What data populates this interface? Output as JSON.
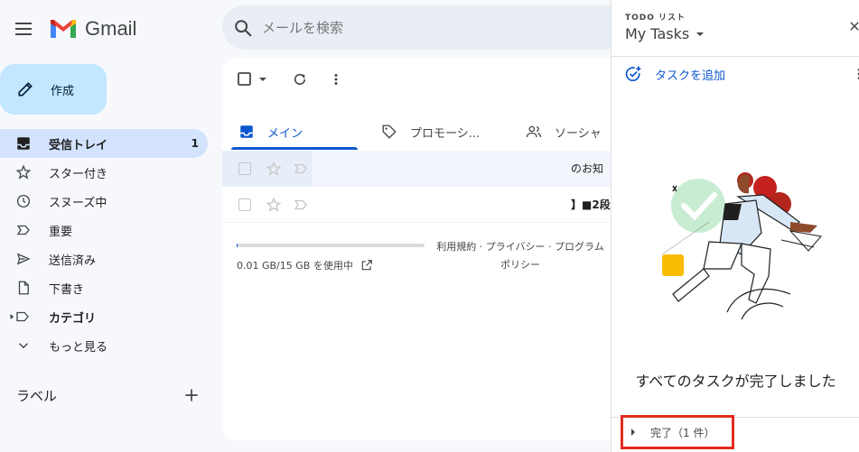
{
  "app": {
    "logo_text": "Gmail"
  },
  "search": {
    "placeholder": "メールを検索"
  },
  "compose": {
    "label": "作成"
  },
  "sidebar": {
    "items": [
      {
        "label": "受信トレイ",
        "count": "1"
      },
      {
        "label": "スター付き"
      },
      {
        "label": "スヌーズ中"
      },
      {
        "label": "重要"
      },
      {
        "label": "送信済み"
      },
      {
        "label": "下書き"
      },
      {
        "label": "カテゴリ"
      },
      {
        "label": "もっと見る"
      }
    ],
    "labels_heading": "ラベル"
  },
  "main": {
    "tabs": [
      {
        "label": "メイン"
      },
      {
        "label": "プロモーシ..."
      },
      {
        "label": "ソーシャ"
      }
    ],
    "emails": [
      {
        "snippet": "のお知"
      },
      {
        "snippet": "】■2段"
      }
    ],
    "storage": {
      "text": "0.01 GB/15 GB を使用中",
      "used_fraction": 0.0007
    },
    "footer": {
      "line1": "利用規約 · プライバシー · プログラム",
      "line2": "ポリシー"
    }
  },
  "tasks_panel": {
    "kicker": "TODO リスト",
    "list_name": "My Tasks",
    "add_task_label": "タスクを追加",
    "empty_message": "すべてのタスクが完了しました",
    "completed_label": "完了（1 件）"
  },
  "colors": {
    "accent": "#0b57d0",
    "compose_bg": "#c2e7ff",
    "active_nav": "#d3e3fd",
    "highlight_box": "#e32c1e"
  }
}
